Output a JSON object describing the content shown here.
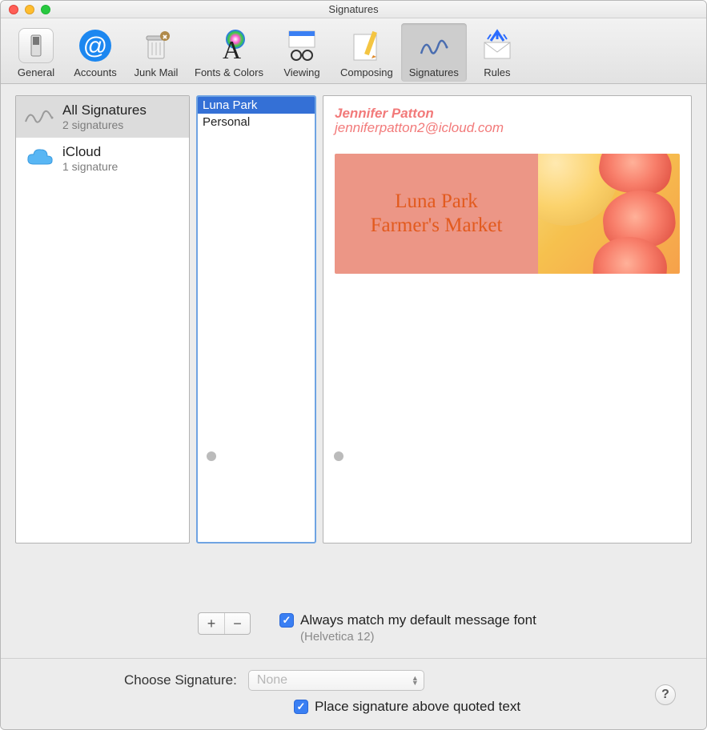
{
  "window": {
    "title": "Signatures"
  },
  "toolbar": {
    "items": [
      {
        "label": "General"
      },
      {
        "label": "Accounts"
      },
      {
        "label": "Junk Mail"
      },
      {
        "label": "Fonts & Colors"
      },
      {
        "label": "Viewing"
      },
      {
        "label": "Composing"
      },
      {
        "label": "Signatures"
      },
      {
        "label": "Rules"
      }
    ]
  },
  "sidebar": {
    "accounts": [
      {
        "title": "All Signatures",
        "sub": "2 signatures",
        "selected": true,
        "icon": "signature"
      },
      {
        "title": "iCloud",
        "sub": "1 signature",
        "selected": false,
        "icon": "cloud"
      }
    ]
  },
  "signatures": {
    "items": [
      {
        "name": "Luna Park",
        "selected": true
      },
      {
        "name": "Personal",
        "selected": false
      }
    ]
  },
  "preview": {
    "name": "Jennifer Patton",
    "email": "jenniferpatton2@icloud.com",
    "banner_text_line1": "Luna Park",
    "banner_text_line2": "Farmer's Market"
  },
  "controls": {
    "add_label": "+",
    "remove_label": "−",
    "match_font_label": "Always match my default message font",
    "match_font_checked": true,
    "font_note": "(Helvetica 12)",
    "choose_label": "Choose Signature:",
    "choose_value": "None",
    "place_above_label": "Place signature above quoted text",
    "place_above_checked": true,
    "help": "?"
  }
}
